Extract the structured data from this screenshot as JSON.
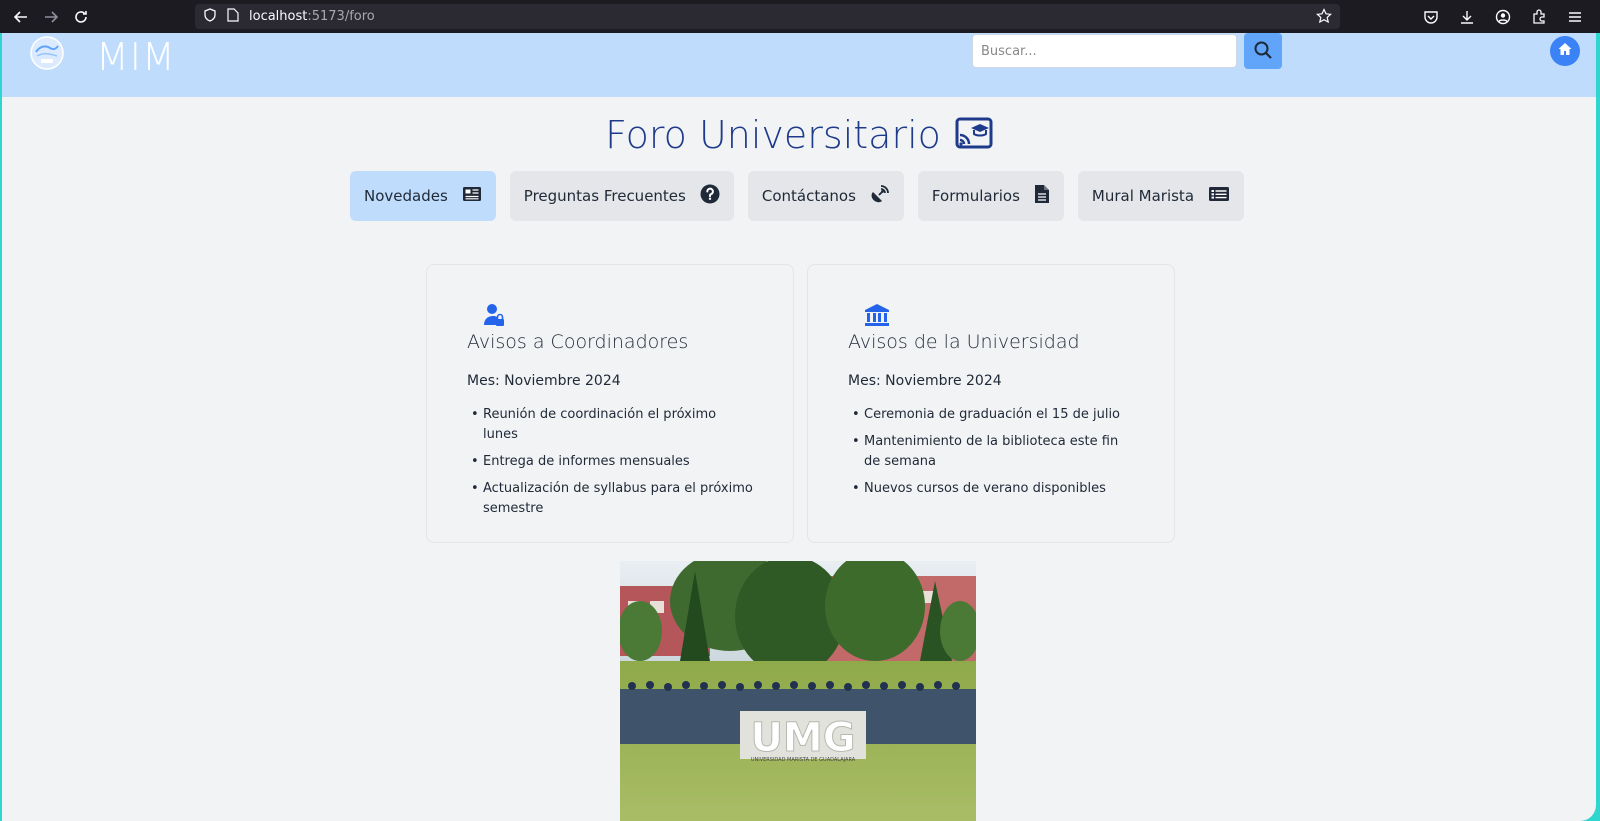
{
  "browser": {
    "url_host": "localhost",
    "url_path": ":5173/foro"
  },
  "header": {
    "brand": "MIM",
    "search_placeholder": "Buscar..."
  },
  "page": {
    "title": "Foro Universitario"
  },
  "tabs": [
    {
      "label": "Novedades",
      "icon": "newspaper-icon",
      "active": true
    },
    {
      "label": "Preguntas Frecuentes",
      "icon": "question-circle-icon",
      "active": false
    },
    {
      "label": "Contáctanos",
      "icon": "satellite-dish-icon",
      "active": false
    },
    {
      "label": "Formularios",
      "icon": "file-icon",
      "active": false
    },
    {
      "label": "Mural Marista",
      "icon": "rectangle-list-icon",
      "active": false
    }
  ],
  "cards": [
    {
      "icon": "user-lock-icon",
      "title": "Avisos a Coordinadores",
      "month": "Mes: Noviembre 2024",
      "items": [
        "Reunión de coordinación el próximo lunes",
        "Entrega de informes mensuales",
        "Actualización de syllabus para el próximo semestre"
      ]
    },
    {
      "icon": "university-icon",
      "title": "Avisos de la Universidad",
      "month": "Mes: Noviembre 2024",
      "items": [
        "Ceremonia de graduación el 15 de julio",
        "Mantenimiento de la biblioteca este fin de semana",
        "Nuevos cursos de verano disponibles"
      ]
    }
  ],
  "photo": {
    "sign_text": "UMG",
    "sign_subtext": "UNIVERSIDAD MARISTA DE GUADALAJARA"
  },
  "colors": {
    "header_bg": "#bfdcfd",
    "accent": "#3b82f6",
    "title": "#1e3a8a",
    "page_bg": "#f2f3f5"
  }
}
